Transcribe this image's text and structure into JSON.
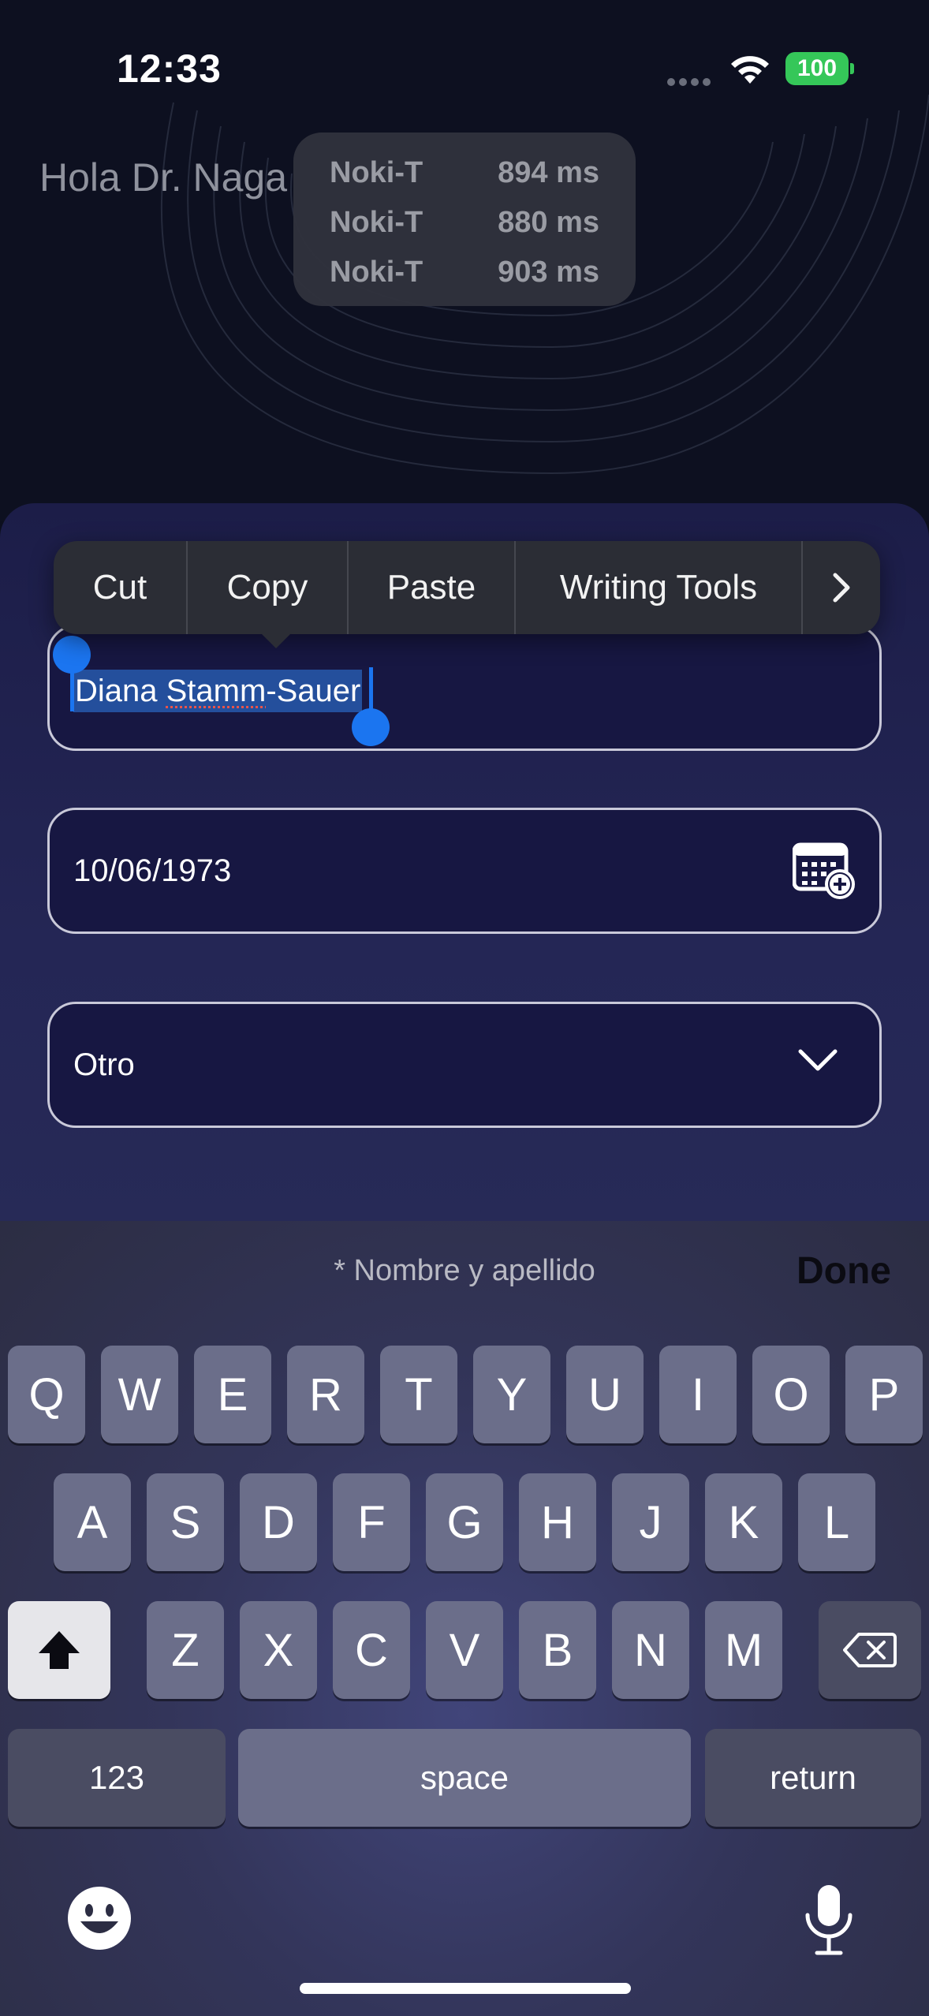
{
  "status_bar": {
    "time": "12:33",
    "battery": "100",
    "battery_color": "#35c759"
  },
  "greeting": "Hola Dr. Naga",
  "latency_overlay": [
    {
      "name": "Noki-T",
      "value": "894 ms"
    },
    {
      "name": "Noki-T",
      "value": "880 ms"
    },
    {
      "name": "Noki-T",
      "value": "903 ms"
    }
  ],
  "context_menu": {
    "items": [
      "Cut",
      "Copy",
      "Paste",
      "Writing Tools"
    ],
    "more_icon": "chevron-right-icon"
  },
  "form": {
    "name_value_first": "Diana ",
    "name_value_spell": "Stamm",
    "name_value_rest": "-Sauer",
    "birthdate": "10/06/1973",
    "birthdate_icon": "calendar-add-icon",
    "sex_value": "Otro",
    "sex_icon": "chevron-down-icon"
  },
  "keyboard": {
    "hint": "* Nombre y apellido",
    "done": "Done",
    "row1": [
      "Q",
      "W",
      "E",
      "R",
      "T",
      "Y",
      "U",
      "I",
      "O",
      "P"
    ],
    "row2": [
      "A",
      "S",
      "D",
      "F",
      "G",
      "H",
      "J",
      "K",
      "L"
    ],
    "row3": [
      "Z",
      "X",
      "C",
      "V",
      "B",
      "N",
      "M"
    ],
    "numbers": "123",
    "space": "space",
    "return": "return",
    "shift_icon": "shift-icon",
    "delete_icon": "delete-icon",
    "emoji_icon": "emoji-icon",
    "mic_icon": "microphone-icon"
  },
  "colors": {
    "accent": "#1b75f0",
    "selection": "#244f9c",
    "sheet": "#1c1d48"
  }
}
